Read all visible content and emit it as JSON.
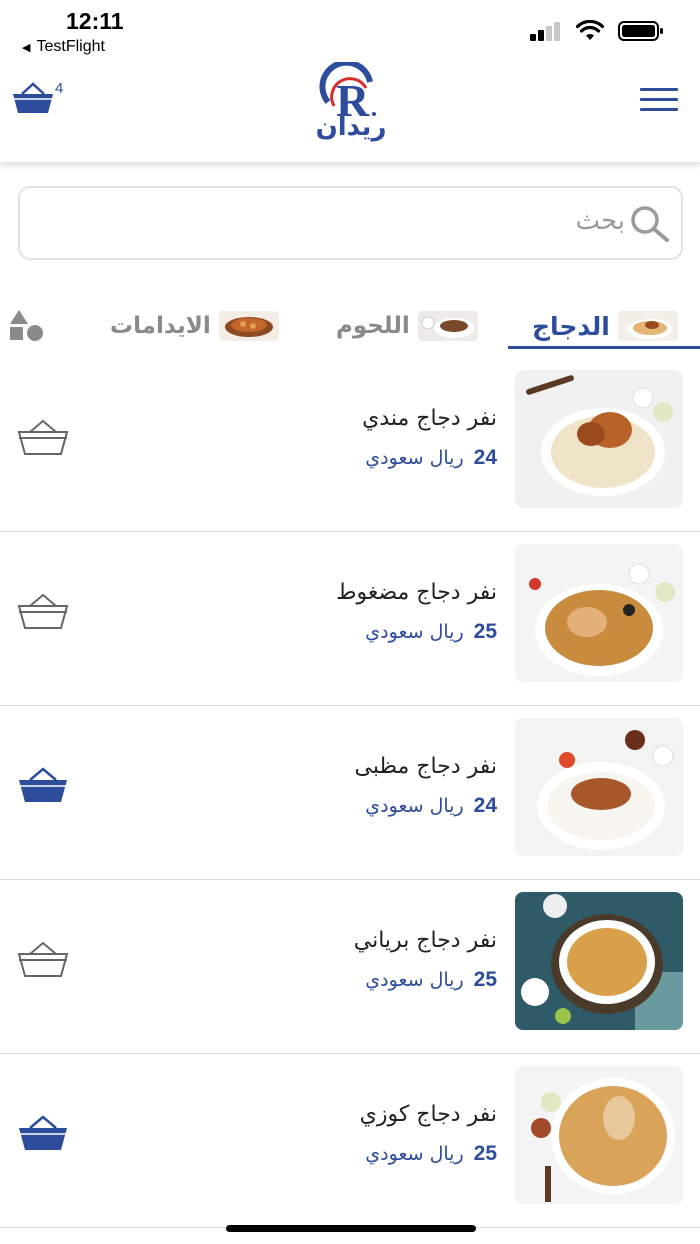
{
  "status_bar": {
    "time": "12:11",
    "back_app": "TestFlight"
  },
  "header": {
    "cart_count": "4",
    "logo_text": "ريدان",
    "brand_color": "#2e4c9c"
  },
  "search": {
    "placeholder": "بحث"
  },
  "tabs": [
    {
      "label": "الدجاج",
      "active": true
    },
    {
      "label": "اللحوم",
      "active": false
    },
    {
      "label": "الايدامات",
      "active": false
    }
  ],
  "items": [
    {
      "name": "نفر دجاج مندي",
      "price": "24",
      "currency": "ريال سعودي",
      "in_cart": false
    },
    {
      "name": "نفر دجاج مضغوط",
      "price": "25",
      "currency": "ريال سعودي",
      "in_cart": false
    },
    {
      "name": "نفر دجاج مظبى",
      "price": "24",
      "currency": "ريال سعودي",
      "in_cart": true
    },
    {
      "name": "نفر دجاج برياني",
      "price": "25",
      "currency": "ريال سعودي",
      "in_cart": false
    },
    {
      "name": "نفر دجاج كوزي",
      "price": "25",
      "currency": "ريال سعودي",
      "in_cart": true
    }
  ],
  "icons": {
    "cart": "basket-icon",
    "menu": "hamburger-menu-icon",
    "search": "search-icon",
    "categories": "shapes-icon"
  }
}
